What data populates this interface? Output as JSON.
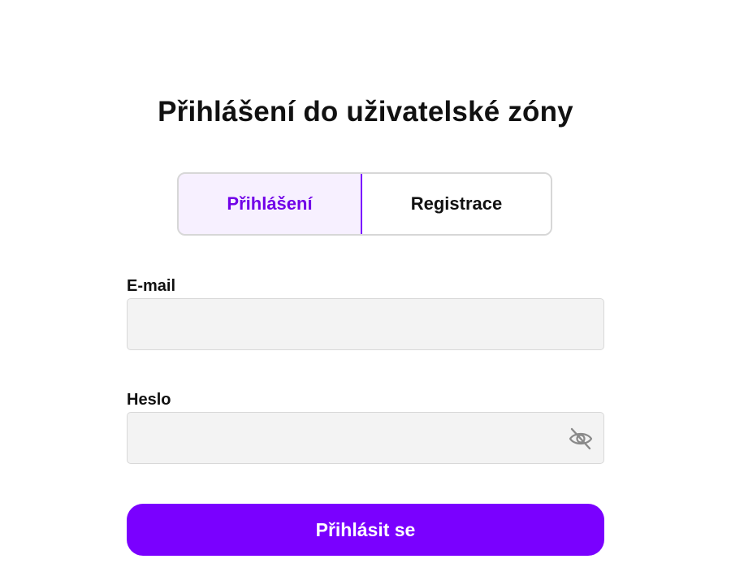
{
  "heading": "Přihlášení do uživatelské zóny",
  "tabs": {
    "login_label": "Přihlášení",
    "register_label": "Registrace",
    "active": "login"
  },
  "form": {
    "email_label": "E-mail",
    "email_value": "",
    "password_label": "Heslo",
    "password_value": "",
    "password_toggle_icon": "eye-slash-icon",
    "submit_label": "Přihlásit se"
  },
  "colors": {
    "accent": "#7a00ff",
    "active_tab_bg": "#f7f0ff",
    "input_bg": "#f3f3f3"
  }
}
